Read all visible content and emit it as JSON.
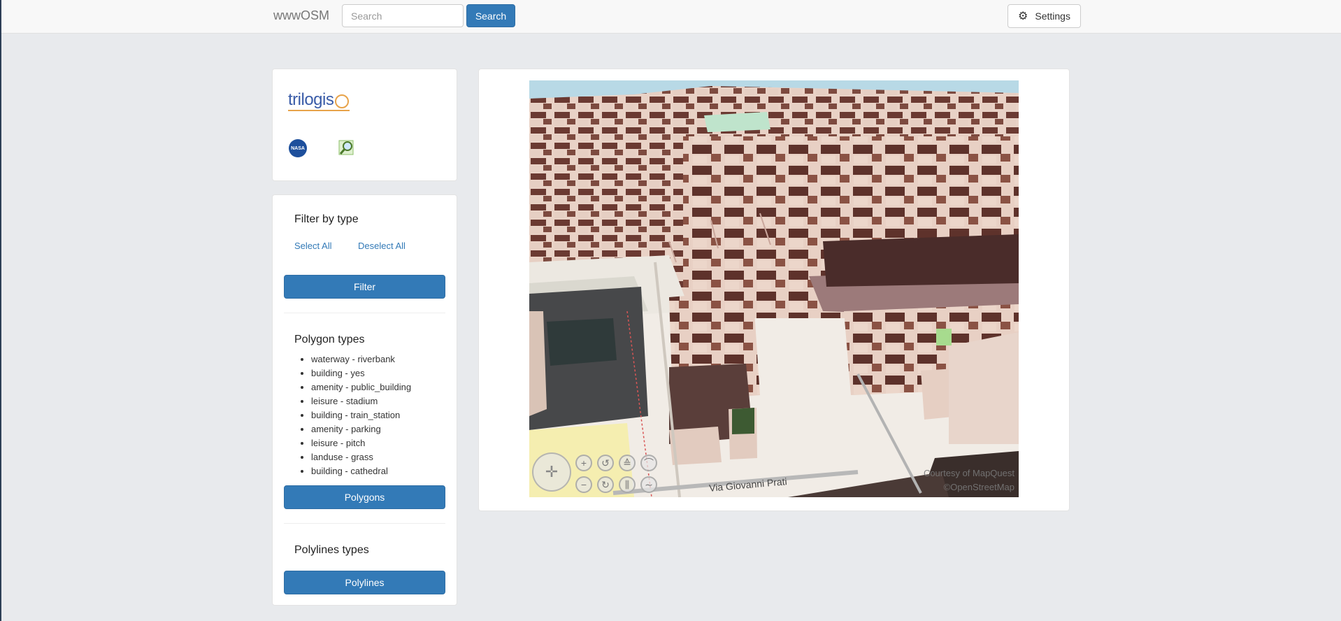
{
  "navbar": {
    "brand": "wwwOSM",
    "search_placeholder": "Search",
    "search_button": "Search",
    "settings_button": "Settings"
  },
  "logos": {
    "trilogis": "trilogis",
    "nasa": "NASA"
  },
  "filter": {
    "title": "Filter by type",
    "select_all": "Select All",
    "deselect_all": "Deselect All",
    "filter_button": "Filter",
    "polygon_title": "Polygon types",
    "polygon_types": [
      "waterway - riverbank",
      "building - yes",
      "amenity - public_building",
      "leisure - stadium",
      "building - train_station",
      "amenity - parking",
      "leisure - pitch",
      "landuse - grass",
      "building - cathedral"
    ],
    "polygons_button": "Polygons",
    "polylines_title": "Polylines types",
    "polylines_button": "Polylines"
  },
  "map": {
    "street_label": "Via Giovanni Prati",
    "attribution_1": "Courtesy of MapQuest",
    "attribution_2": "©OpenStreetMap"
  }
}
